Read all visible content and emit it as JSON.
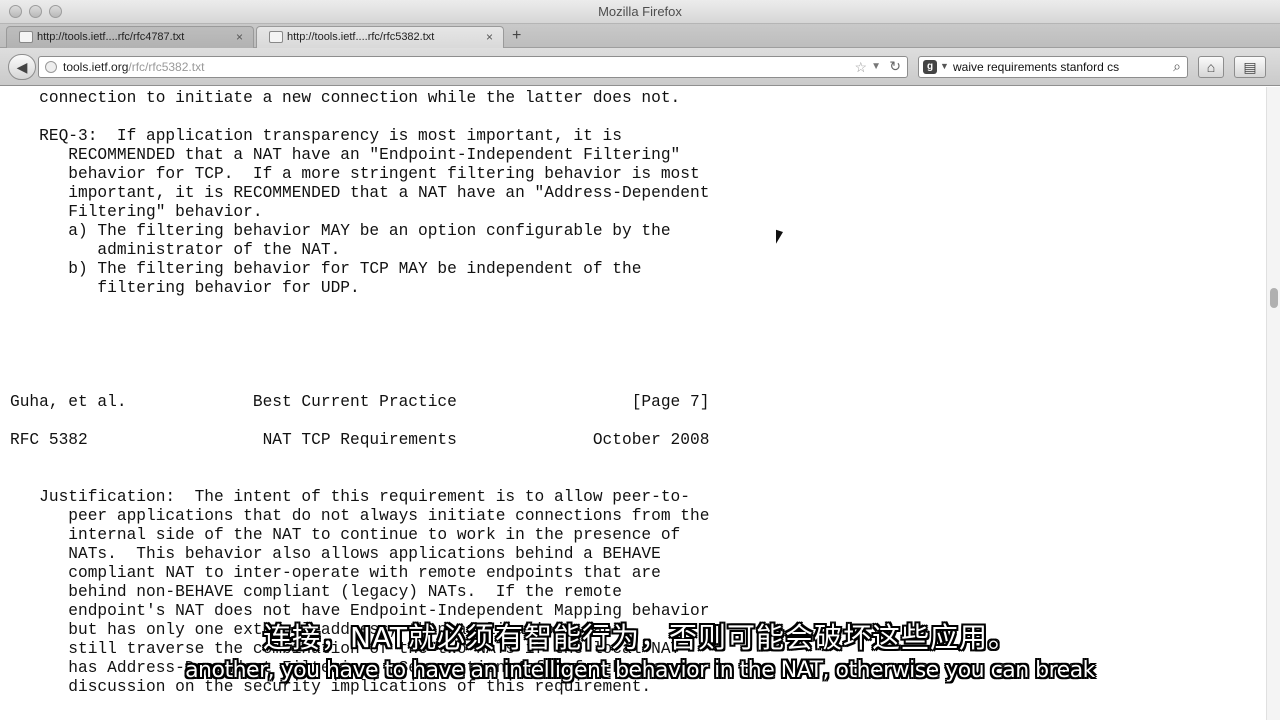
{
  "window": {
    "title": "Mozilla Firefox"
  },
  "tabs": [
    {
      "label": "http://tools.ietf....rfc/rfc4787.txt",
      "active": false
    },
    {
      "label": "http://tools.ietf....rfc/rfc5382.txt",
      "active": true
    }
  ],
  "newtab_label": "+",
  "url": {
    "host": "tools.ietf.org",
    "path": "/rfc/rfc5382.txt"
  },
  "search": {
    "engine_icon": "google-icon",
    "value": "waive requirements stanford cs"
  },
  "page_text": "   connection to initiate a new connection while the latter does not.\n\n   REQ-3:  If application transparency is most important, it is\n      RECOMMENDED that a NAT have an \"Endpoint-Independent Filtering\"\n      behavior for TCP.  If a more stringent filtering behavior is most\n      important, it is RECOMMENDED that a NAT have an \"Address-Dependent\n      Filtering\" behavior.\n      a) The filtering behavior MAY be an option configurable by the\n         administrator of the NAT.\n      b) The filtering behavior for TCP MAY be independent of the\n         filtering behavior for UDP.\n\n\n\n\n\nGuha, et al.             Best Current Practice                  [Page 7]\n\nRFC 5382                  NAT TCP Requirements              October 2008\n\n\n   Justification:  The intent of this requirement is to allow peer-to-\n      peer applications that do not always initiate connections from the\n      internal side of the NAT to continue to work in the presence of\n      NATs.  This behavior also allows applications behind a BEHAVE\n      compliant NAT to inter-operate with remote endpoints that are\n      behind non-BEHAVE compliant (legacy) NATs.  If the remote\n      endpoint's NAT does not have Endpoint-Independent Mapping behavior\n      but has only one external address, then applications can\n      still traverse the combination of the two NATs if the local NAT\n      has Address-Dependent Filtering.  See section 4 for further\n      discussion on the security implications of this requirement.",
  "subtitles": {
    "zh": "连接，NAT就必须有智能行为，否则可能会破坏这些应用。",
    "en": "another, you have to have an intelligent behavior in the NAT, otherwise you can break"
  }
}
